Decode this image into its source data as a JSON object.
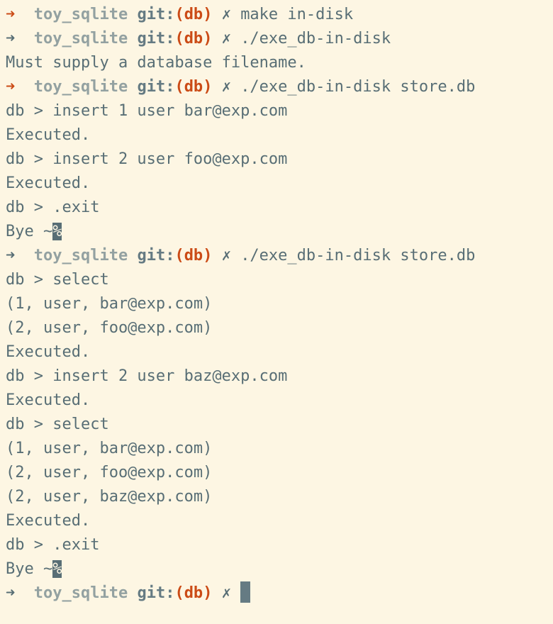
{
  "prompt": {
    "arrow": "➜",
    "dir": "toy_sqlite",
    "git_label": "git:",
    "open_paren": "(",
    "branch": "db",
    "close_paren": ")",
    "dirty_mark": "✗"
  },
  "colors": {
    "background": "#fdf6e3",
    "text": "#586e75",
    "accent": "#cb4b16",
    "dim": "#93a1a1"
  },
  "lines": [
    {
      "type": "prompt",
      "status": "error",
      "cmd": "make in-disk"
    },
    {
      "type": "prompt",
      "status": "ok",
      "cmd": "./exe_db-in-disk"
    },
    {
      "type": "output",
      "text": "Must supply a database filename."
    },
    {
      "type": "prompt",
      "status": "error",
      "cmd": "./exe_db-in-disk store.db"
    },
    {
      "type": "output",
      "text": "db > insert 1 user bar@exp.com"
    },
    {
      "type": "output",
      "text": "Executed."
    },
    {
      "type": "output",
      "text": "db > insert 2 user foo@exp.com"
    },
    {
      "type": "output",
      "text": "Executed."
    },
    {
      "type": "output",
      "text": "db > .exit"
    },
    {
      "type": "bye",
      "text": "Bye ~",
      "mark": "%"
    },
    {
      "type": "prompt",
      "status": "ok",
      "cmd": "./exe_db-in-disk store.db"
    },
    {
      "type": "output",
      "text": "db > select"
    },
    {
      "type": "output",
      "text": "(1, user, bar@exp.com)"
    },
    {
      "type": "output",
      "text": "(2, user, foo@exp.com)"
    },
    {
      "type": "output",
      "text": "Executed."
    },
    {
      "type": "output",
      "text": "db > insert 2 user baz@exp.com"
    },
    {
      "type": "output",
      "text": "Executed."
    },
    {
      "type": "output",
      "text": "db > select"
    },
    {
      "type": "output",
      "text": "(1, user, bar@exp.com)"
    },
    {
      "type": "output",
      "text": "(2, user, foo@exp.com)"
    },
    {
      "type": "output",
      "text": "(2, user, baz@exp.com)"
    },
    {
      "type": "output",
      "text": "Executed."
    },
    {
      "type": "output",
      "text": "db > .exit"
    },
    {
      "type": "bye",
      "text": "Bye ~",
      "mark": "%"
    },
    {
      "type": "prompt",
      "status": "ok",
      "cmd": "",
      "cursor": true
    }
  ]
}
